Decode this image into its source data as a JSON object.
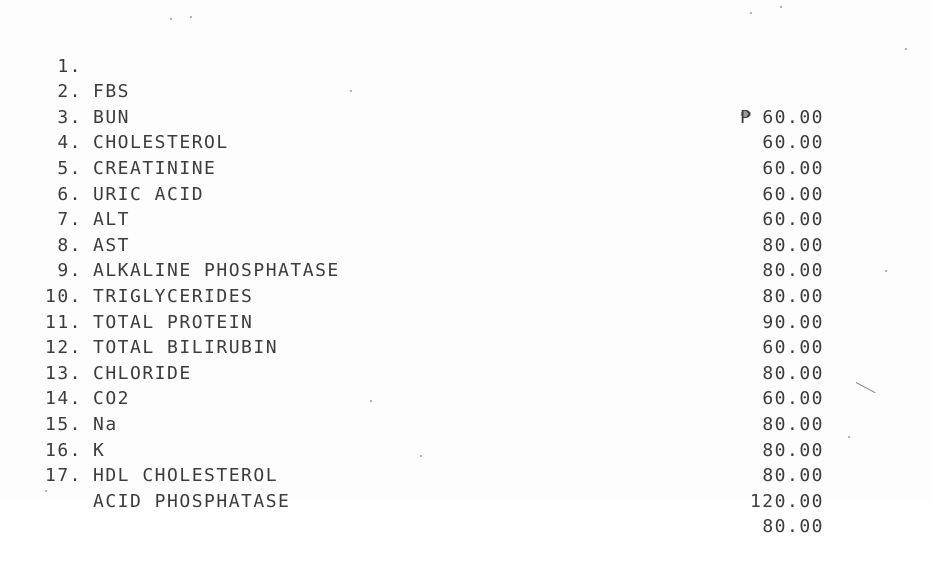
{
  "price_list": {
    "currency_symbol": "₱",
    "items": [
      {
        "num": "1.",
        "name": "FBS",
        "price": "60.00"
      },
      {
        "num": "2.",
        "name": "BUN",
        "price": "60.00"
      },
      {
        "num": "3.",
        "name": "CHOLESTEROL",
        "price": "60.00"
      },
      {
        "num": "4.",
        "name": "CREATININE",
        "price": "60.00"
      },
      {
        "num": "5.",
        "name": "URIC ACID",
        "price": "60.00"
      },
      {
        "num": "6.",
        "name": "ALT",
        "price": "80.00"
      },
      {
        "num": "7.",
        "name": "AST",
        "price": "80.00"
      },
      {
        "num": "8.",
        "name": "ALKALINE PHOSPHATASE",
        "price": "80.00"
      },
      {
        "num": "9.",
        "name": "TRIGLYCERIDES",
        "price": "90.00"
      },
      {
        "num": "10.",
        "name": "TOTAL PROTEIN",
        "price": "60.00"
      },
      {
        "num": "11.",
        "name": "TOTAL BILIRUBIN",
        "price": "80.00"
      },
      {
        "num": "12.",
        "name": "CHLORIDE",
        "price": "60.00"
      },
      {
        "num": "13.",
        "name": "CO2",
        "price": "80.00"
      },
      {
        "num": "14.",
        "name": "Na",
        "price": "80.00"
      },
      {
        "num": "15.",
        "name": "K",
        "price": "80.00"
      },
      {
        "num": "16.",
        "name": "HDL CHOLESTEROL",
        "price": "120.00"
      },
      {
        "num": "17.",
        "name": "ACID PHOSPHATASE",
        "price": "80.00"
      }
    ]
  }
}
